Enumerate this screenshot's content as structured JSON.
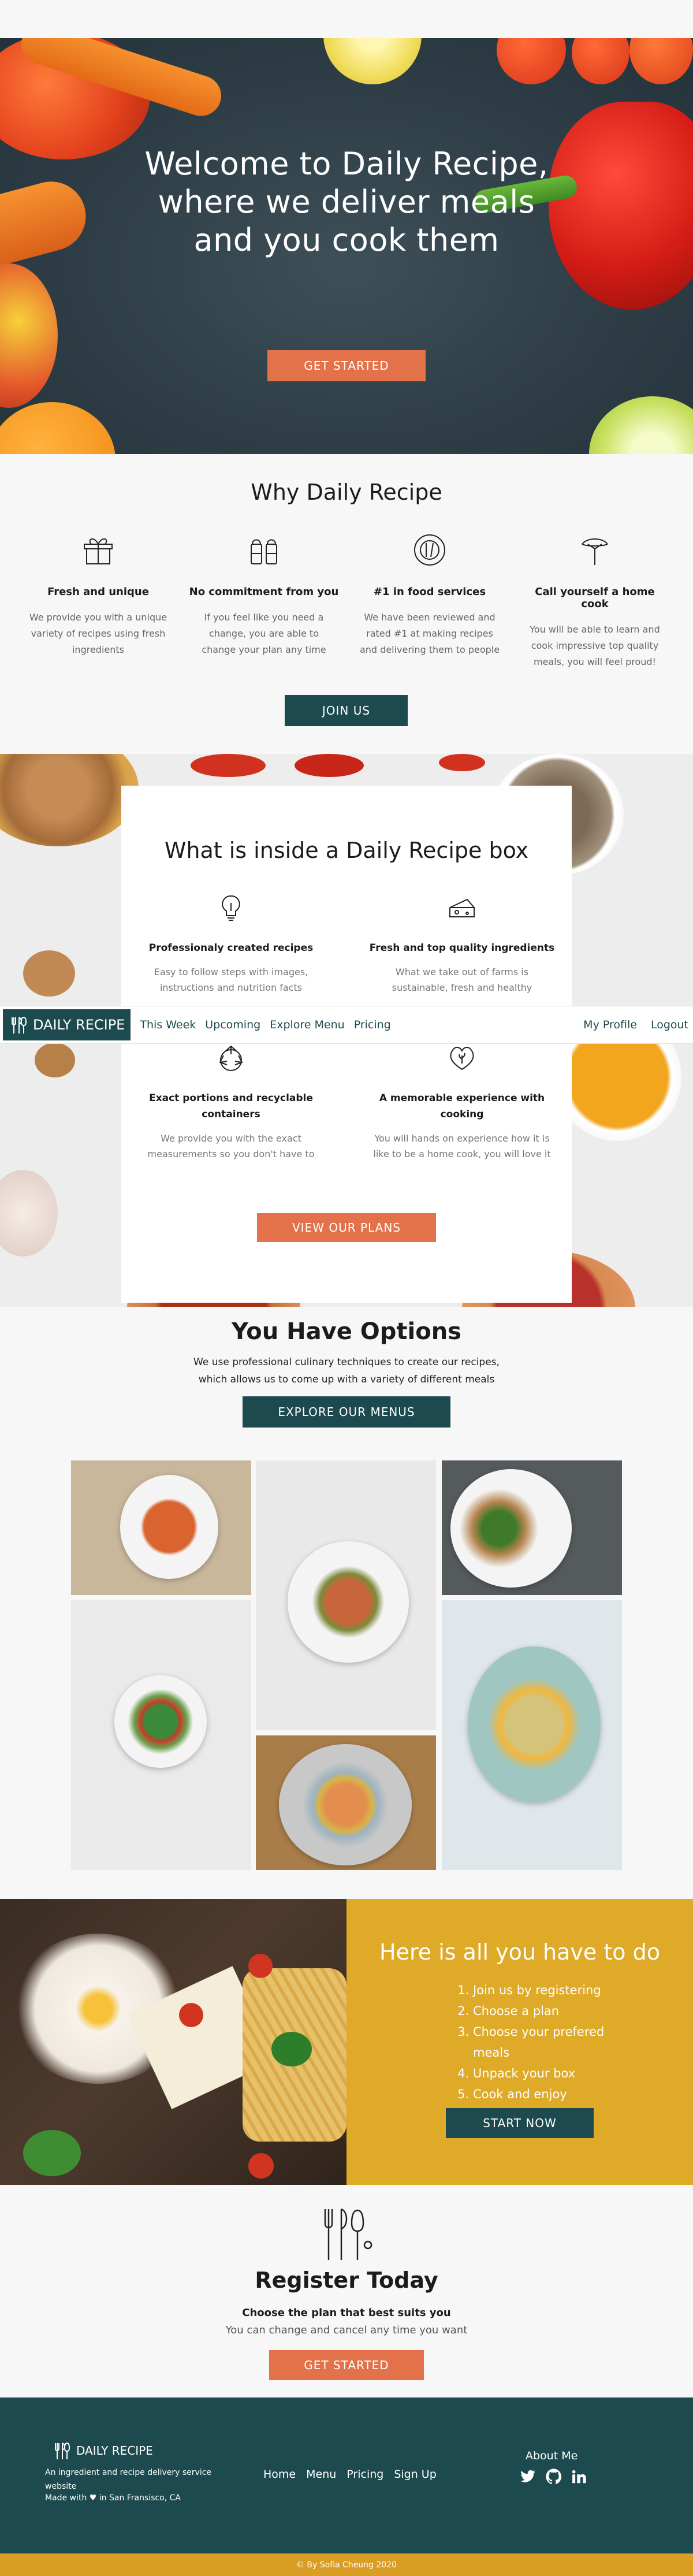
{
  "hero": {
    "title": "Welcome to Daily Recipe, where we deliver meals and you cook them",
    "cta_label": "GET STARTED"
  },
  "why": {
    "title": "Why Daily Recipe",
    "features": [
      {
        "icon": "gift-box-icon",
        "title": "Fresh and unique",
        "text": "We provide you with a unique variety of recipes using fresh ingredients"
      },
      {
        "icon": "salt-pepper-icon",
        "title": "No commitment from you",
        "text": "If you feel like you need a change, you are able to change your plan any time"
      },
      {
        "icon": "plate-cutlery-icon",
        "title": "#1 in food services",
        "text": "We have been reviewed and rated #1 at making recipes and delivering them to people"
      },
      {
        "icon": "whisk-icon",
        "title": "Call yourself a home cook",
        "text": "You will be able to learn and cook impressive top quality meals, you will feel proud!"
      }
    ],
    "cta_label": "JOIN US"
  },
  "inside": {
    "title": "What is inside a Daily Recipe box",
    "features": [
      {
        "icon": "lightbulb-icon",
        "title": "Professionaly created recipes",
        "text": "Easy to follow steps with images, instructions and nutrition facts"
      },
      {
        "icon": "cheese-icon",
        "title": "Fresh and top quality ingredients",
        "text": "What we take out of farms is sustainable, fresh and healthy"
      },
      {
        "icon": "recycle-icon",
        "title": "Exact portions and recyclable containers",
        "text": "We provide you with the exact measurements so you don't have to"
      },
      {
        "icon": "heart-leaf-icon",
        "title": "A memorable experience with cooking",
        "text": "You will hands on experience how it is like to be a home cook, you will love it"
      }
    ],
    "cta_label": "VIEW OUR PLANS"
  },
  "nav": {
    "brand": "DAILY RECIPE",
    "links": [
      "This Week",
      "Upcoming",
      "Explore Menu",
      "Pricing"
    ],
    "right_links": [
      "My Profile",
      "Logout"
    ]
  },
  "options": {
    "title": "You Have Options",
    "subtitle_line1": "We use professional culinary techniques to create our recipes,",
    "subtitle_line2": "which allows us to come up with a variety of different meals",
    "cta_label": "EXPLORE OUR MENUS"
  },
  "steps": {
    "title": "Here is all you have to do",
    "items": [
      "Join us by registering",
      "Choose a plan",
      "Choose your prefered meals",
      "Unpack your box",
      "Cook and enjoy"
    ],
    "cta_label": "START NOW"
  },
  "register": {
    "title": "Register Today",
    "subtitle": "Choose the plan that best suits you",
    "text": "You can change and cancel any time you want",
    "cta_label": "GET STARTED"
  },
  "footer": {
    "brand": "DAILY RECIPE",
    "tagline": "An ingredient and recipe delivery service website",
    "made_with": "Made with ♥ in San Fransisco, CA",
    "links": [
      "Home",
      "Menu",
      "Pricing",
      "Sign Up"
    ],
    "about_title": "About Me",
    "copyright": "© By Sofia Cheung 2020"
  },
  "colors": {
    "accent": "#e3724b",
    "dark": "#1c4a4e",
    "mustard": "#deaa27"
  }
}
